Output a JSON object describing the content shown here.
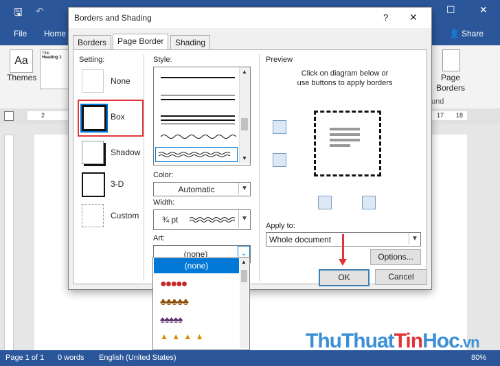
{
  "word": {
    "tabs": [
      "File",
      "Home"
    ],
    "share_label": "Share",
    "themes_label": "Themes",
    "style_preview_title": "Title",
    "style_preview_heading": "Heading 1",
    "page_borders_label": "Page Borders",
    "ribbon_group_fragment": "und",
    "ruler_marks": [
      "2",
      "17",
      "18"
    ],
    "status_page": "Page 1 of 1",
    "status_words": "0 words",
    "status_lang": "English (United States)",
    "zoom": "80%"
  },
  "dialog": {
    "title": "Borders and Shading",
    "help": "?",
    "close": "✕",
    "tabs": [
      "Borders",
      "Page Border",
      "Shading"
    ],
    "active_tab": "Page Border",
    "setting_label": "Setting:",
    "settings": [
      {
        "label": "None"
      },
      {
        "label": "Box"
      },
      {
        "label": "Shadow"
      },
      {
        "label": "3-D"
      },
      {
        "label": "Custom"
      }
    ],
    "selected_setting": "Box",
    "style_label": "Style:",
    "color_label": "Color:",
    "color_value": "Automatic",
    "width_label": "Width:",
    "width_value": "¾ pt",
    "art_label": "Art:",
    "art_value": "(none)",
    "art_options": [
      "(none)"
    ],
    "preview_label": "Preview",
    "preview_hint_line1": "Click on diagram below or",
    "preview_hint_line2": "use buttons to apply borders",
    "apply_to_label": "Apply to:",
    "apply_to_value": "Whole document",
    "options_button": "Options...",
    "ok_button": "OK",
    "cancel_button": "Cancel"
  },
  "watermark": {
    "part1": "Thu",
    "part2": "Thuat",
    "part3": "Tin",
    "part4": "Hoc",
    "part5": ".vn"
  },
  "colors": {
    "accent": "#2b579a",
    "highlight_red": "#e0353a",
    "selected_blue": "#0078d7"
  }
}
